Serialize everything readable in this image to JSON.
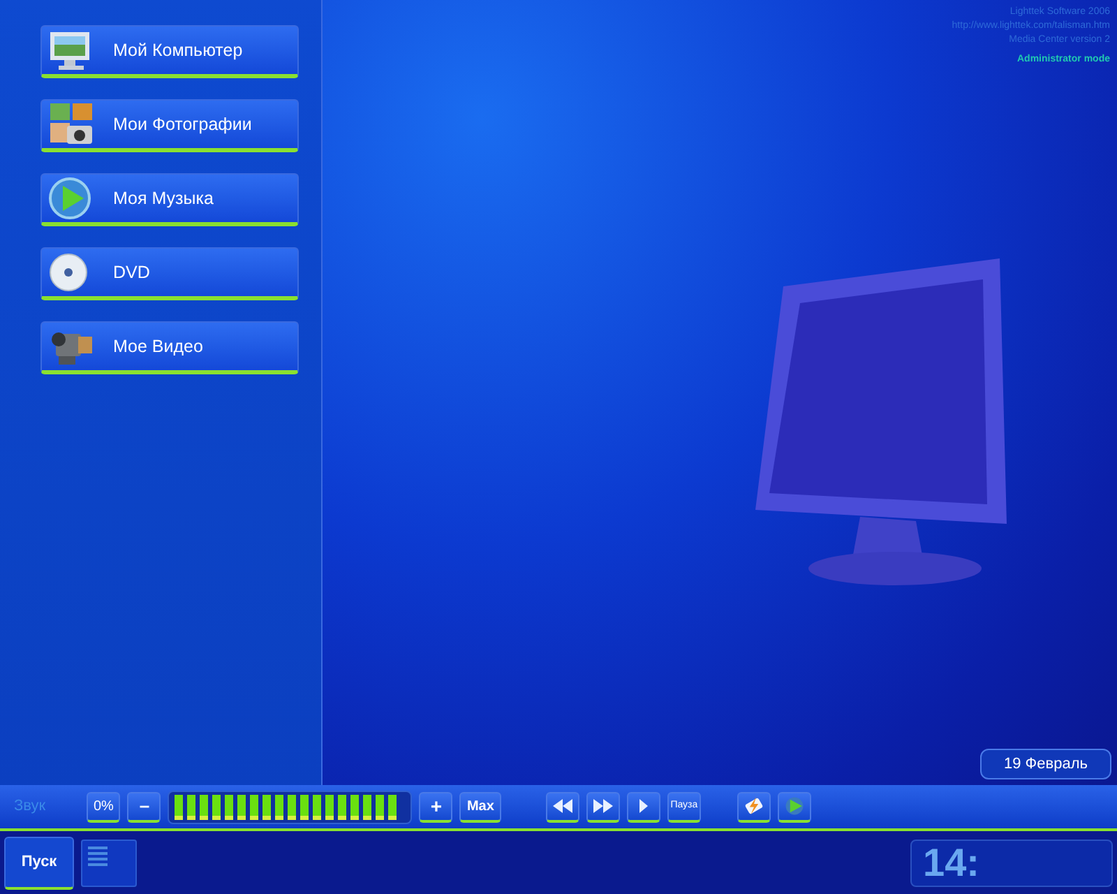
{
  "menu": [
    {
      "label": "Мой Компьютер",
      "kind": "computer"
    },
    {
      "label": "Мои Фотографии",
      "kind": "photos"
    },
    {
      "label": "Моя Музыка",
      "kind": "music"
    },
    {
      "label": "DVD",
      "kind": "dvd"
    },
    {
      "label": "Мое Видео",
      "kind": "video"
    }
  ],
  "info": {
    "lines": [
      "Lighttek Software 2006",
      "http://www.lighttek.com/talisman.htm",
      "Media Center version 2"
    ],
    "mode": "Administrator mode"
  },
  "date": "19 Февраль",
  "sound": {
    "label": "Звук",
    "mute": "0%",
    "minus": "–",
    "level": 1,
    "plus": "+",
    "max": "Max"
  },
  "transport": [
    {
      "kind": "rewind"
    },
    {
      "kind": "forward"
    },
    {
      "kind": "play"
    },
    {
      "kind": "text",
      "label": "Пауза"
    }
  ],
  "apps": [
    {
      "kind": "lightning"
    },
    {
      "kind": "player"
    }
  ],
  "taskbar": {
    "start": "Пуск",
    "clock": "14:"
  }
}
